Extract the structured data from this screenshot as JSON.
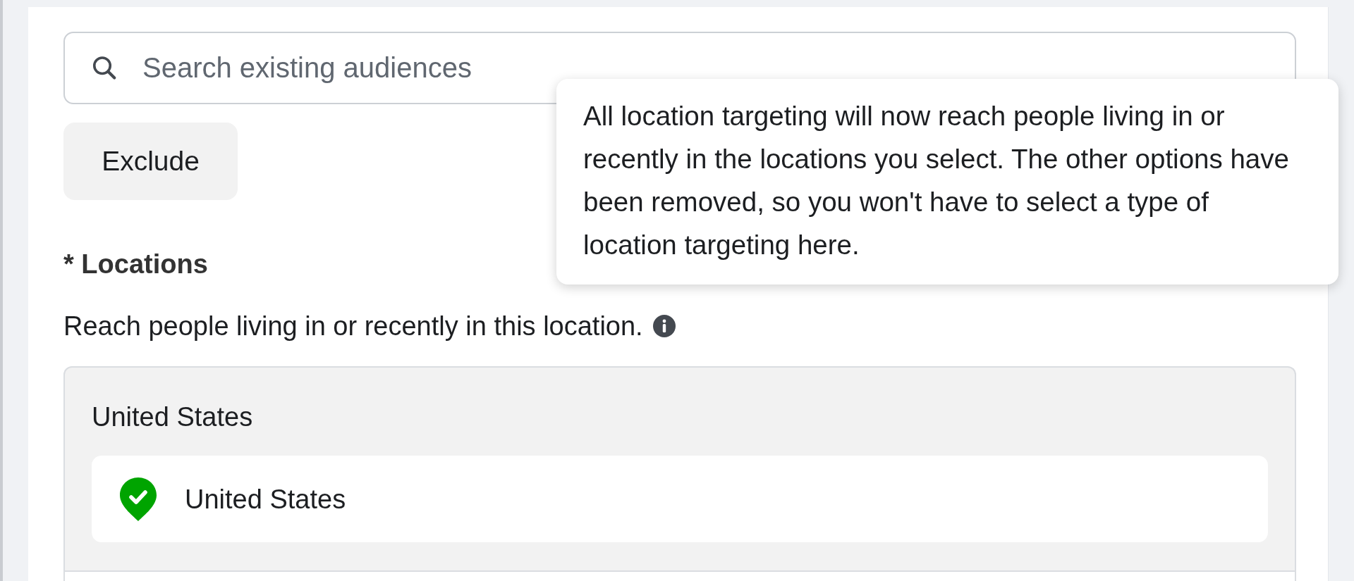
{
  "search": {
    "placeholder": "Search existing audiences"
  },
  "exclude_button": {
    "label": "Exclude"
  },
  "locations": {
    "title": "* Locations",
    "description": "Reach people living in or recently in this location.",
    "group": {
      "title": "United States",
      "items": [
        {
          "name": "United States",
          "included": true
        }
      ]
    }
  },
  "tooltip": {
    "text": "All location targeting will now reach people living in or recently in the locations you select. The other options have been removed, so you won't have to select a type of location targeting here."
  }
}
